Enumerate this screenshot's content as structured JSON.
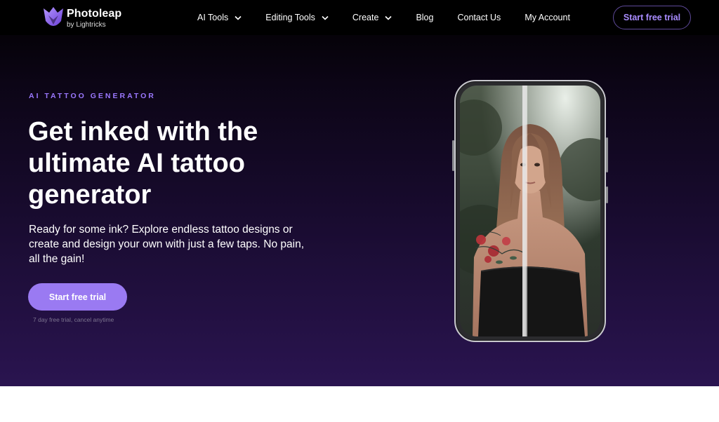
{
  "brand": {
    "name": "Photoleap",
    "subtitle": "by Lightricks",
    "accent": "#9a7af2",
    "logo_icon": "photoleap-logo-icon"
  },
  "nav": {
    "items": [
      {
        "label": "AI Tools",
        "has_dropdown": true
      },
      {
        "label": "Editing Tools",
        "has_dropdown": true
      },
      {
        "label": "Create",
        "has_dropdown": true
      },
      {
        "label": "Blog",
        "has_dropdown": false
      },
      {
        "label": "Contact Us",
        "has_dropdown": false
      },
      {
        "label": "My Account",
        "has_dropdown": false
      }
    ],
    "cta_label": "Start free trial"
  },
  "hero": {
    "eyebrow": "AI TATTOO GENERATOR",
    "headline": "Get inked with the ultimate AI tattoo generator",
    "subcopy": "Ready for some ink? Explore endless tattoo designs or create and design your own with just a few taps. No pain, all the gain!",
    "cta_label": "Start free trial",
    "cta_note": "7 day free trial, cancel anytime",
    "image": "phone-mockup-before-after-tattoo"
  }
}
